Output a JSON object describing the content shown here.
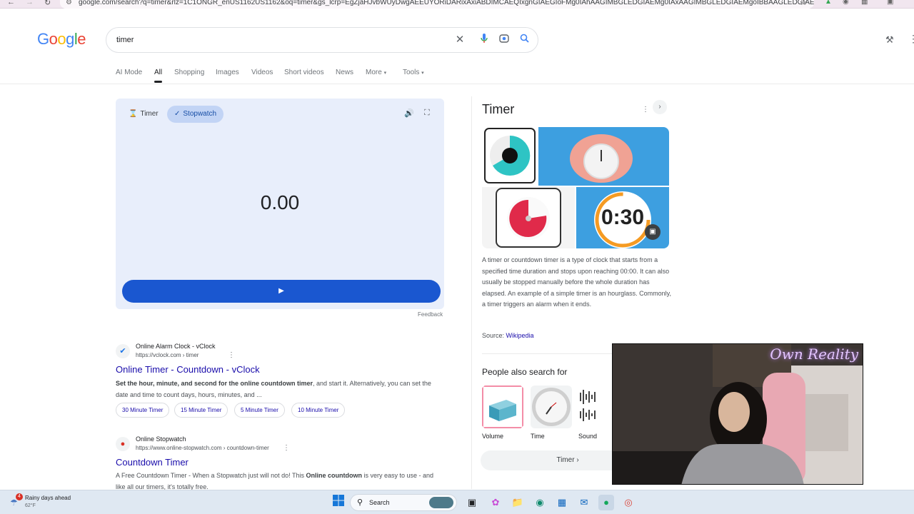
{
  "browser": {
    "url": "google.com/search?q=timer&rlz=1C1ONGR_enUS1162US1162&oq=timer&gs_lcrp=EgZjaHJvbWUyDwgAEEUYORiDARixAxiABDIMCAEQIxgnGIAEGIoFMg0IAhAAGIMBGLEDGIAEMg0IAxAAGIMBGLEDGIAEMgoIBBAAGLEDGIAEMgo..."
  },
  "header": {
    "logo": "Google",
    "logo_colors": [
      "#4285F4",
      "#EA4335",
      "#FBBC05",
      "#4285F4",
      "#34A853",
      "#EA4335"
    ],
    "search_value": "timer"
  },
  "tabs": [
    {
      "label": "AI Mode"
    },
    {
      "label": "All"
    },
    {
      "label": "Shopping"
    },
    {
      "label": "Images"
    },
    {
      "label": "Videos"
    },
    {
      "label": "Short videos"
    },
    {
      "label": "News"
    },
    {
      "label": "More"
    },
    {
      "label": "Tools"
    }
  ],
  "stopwatch": {
    "timer_tab": "Timer",
    "stopwatch_tab": "Stopwatch",
    "display": "0.00",
    "feedback": "Feedback",
    "accent": "#1a57d0"
  },
  "results": [
    {
      "site_name": "Online Alarm Clock - vClock",
      "url": "https://vclock.com › timer",
      "title": "Online Timer - Countdown - vClock",
      "snippet_bold": "Set the hour, minute, and second for the online countdown timer",
      "snippet_rest": ", and start it. Alternatively, you can set the date and time to count days, hours, minutes, and ...",
      "chips": [
        "30 Minute Timer",
        "15 Minute Timer",
        "5 Minute Timer",
        "10 Minute Timer"
      ]
    },
    {
      "site_name": "Online Stopwatch",
      "url": "https://www.online-stopwatch.com › countdown-timer",
      "title": "Countdown Timer",
      "snippet_a": "A Free Countdown Timer - When a Stopwatch just will not do! This ",
      "snippet_bold": "Online countdown",
      "snippet_b": " is very easy to use - and like all our timers, it's totally free."
    }
  ],
  "knowledge_panel": {
    "title": "Timer",
    "image_timer_text": "0:30",
    "description": "A timer or countdown timer is a type of clock that starts from a specified time duration and stops upon reaching 00:00. It can also usually be stopped manually before the whole duration has elapsed. An example of a simple timer is an hourglass. Commonly, a timer triggers an alarm when it ends.",
    "source_label": "Source: ",
    "source_link": "Wikipedia",
    "people_also_search": "People also search for",
    "pas_items": [
      "Volume",
      "Time",
      "Sound"
    ],
    "pas_button": "Timer"
  },
  "webcam": {
    "neon_text": "Own Reality"
  },
  "taskbar": {
    "weather_badge": "4",
    "weather_text": "Rainy days ahead",
    "weather_temp": "62°F",
    "search_placeholder": "Search"
  }
}
